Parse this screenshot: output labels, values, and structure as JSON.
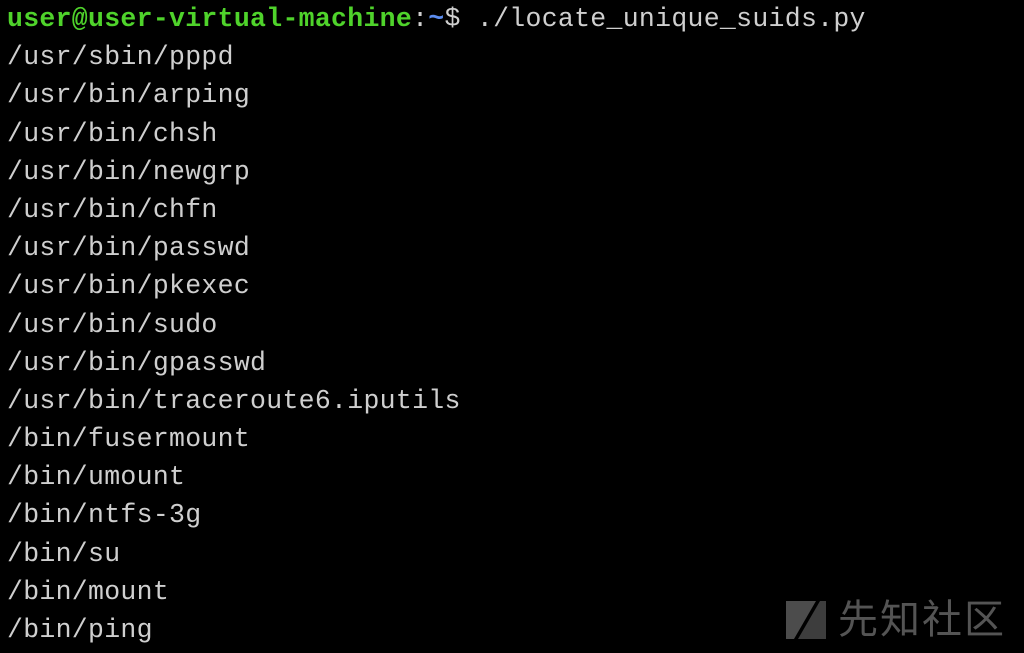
{
  "terminal": {
    "prompt": {
      "user_host": "user@user-virtual-machine",
      "separator": ":",
      "path": "~",
      "dollar": "$",
      "command": " ./locate_unique_suids.py"
    },
    "output": [
      "/usr/sbin/pppd",
      "/usr/bin/arping",
      "/usr/bin/chsh",
      "/usr/bin/newgrp",
      "/usr/bin/chfn",
      "/usr/bin/passwd",
      "/usr/bin/pkexec",
      "/usr/bin/sudo",
      "/usr/bin/gpasswd",
      "/usr/bin/traceroute6.iputils",
      "/bin/fusermount",
      "/bin/umount",
      "/bin/ntfs-3g",
      "/bin/su",
      "/bin/mount",
      "/bin/ping"
    ]
  },
  "watermark": {
    "text": "先知社区",
    "icon": "xianzhi-logo-icon"
  },
  "colors": {
    "background": "#000000",
    "text": "#cfcfcf",
    "user_host": "#4fd32b",
    "path": "#5c8df0"
  }
}
